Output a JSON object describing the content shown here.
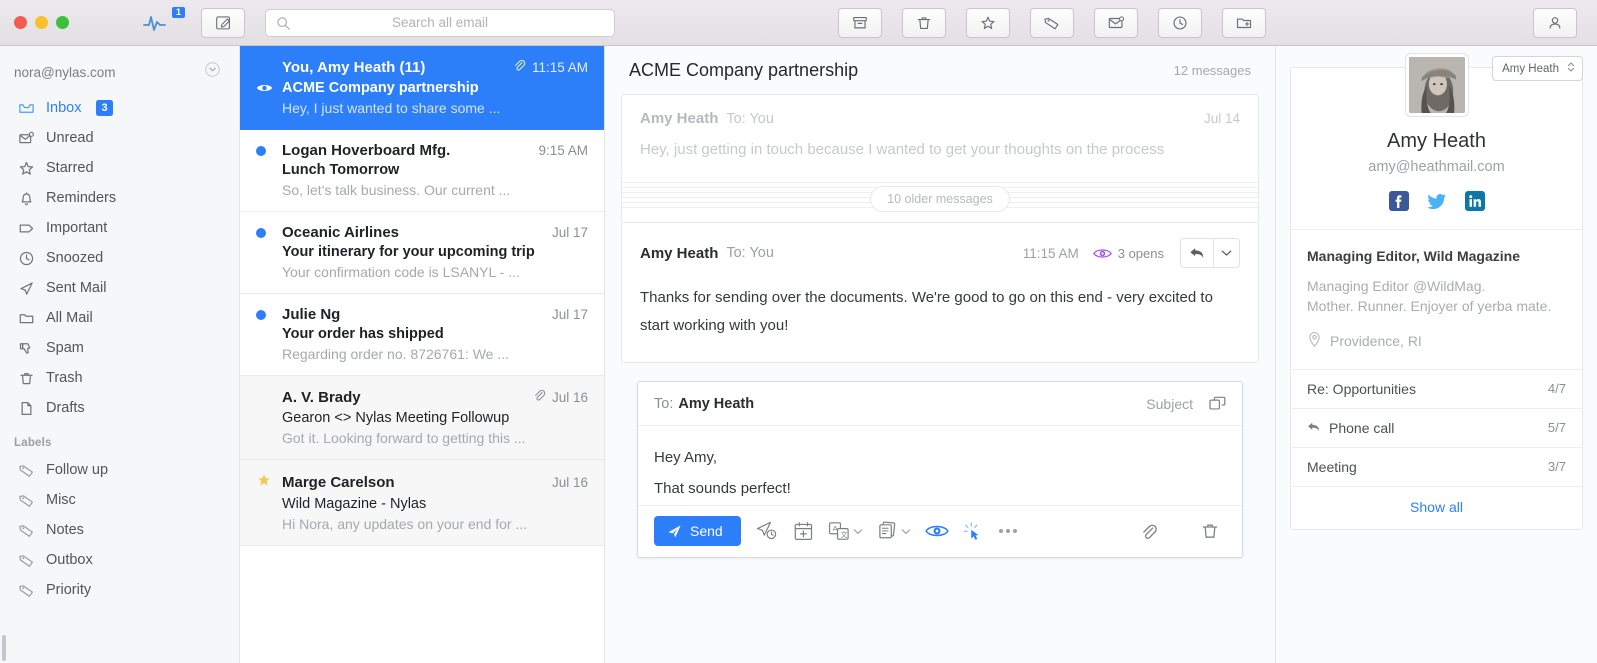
{
  "titlebar": {
    "window_controls": [
      "close",
      "minimize",
      "zoom"
    ],
    "logo_badge": "1",
    "compose_icon": "compose-icon",
    "toolbar_icons": [
      "archive-icon",
      "trash-icon",
      "star-icon",
      "tag-icon",
      "mark-unread-icon",
      "snooze-clock-icon",
      "move-to-folder-icon"
    ],
    "account_icon": "person-icon"
  },
  "search": {
    "placeholder": "Search all email",
    "value": ""
  },
  "sidebar": {
    "account_email": "nora@nylas.com",
    "items": [
      {
        "label": "Inbox",
        "icon": "inbox-icon",
        "badge": "3",
        "active": true
      },
      {
        "label": "Unread",
        "icon": "unread-envelope-icon",
        "badge": "",
        "active": false
      },
      {
        "label": "Starred",
        "icon": "star-icon",
        "badge": "",
        "active": false
      },
      {
        "label": "Reminders",
        "icon": "bell-icon",
        "badge": "",
        "active": false
      },
      {
        "label": "Important",
        "icon": "tag-outline-icon",
        "badge": "",
        "active": false
      },
      {
        "label": "Snoozed",
        "icon": "clock-icon",
        "badge": "",
        "active": false
      },
      {
        "label": "Sent Mail",
        "icon": "paper-plane-icon",
        "badge": "",
        "active": false
      },
      {
        "label": "All Mail",
        "icon": "folder-icon",
        "badge": "",
        "active": false
      },
      {
        "label": "Spam",
        "icon": "thumbs-down-icon",
        "badge": "",
        "active": false
      },
      {
        "label": "Trash",
        "icon": "trash-icon",
        "badge": "",
        "active": false
      },
      {
        "label": "Drafts",
        "icon": "document-icon",
        "badge": "",
        "active": false
      }
    ],
    "labels_header": "Labels",
    "labels": [
      {
        "label": "Follow up",
        "icon": "tag-icon"
      },
      {
        "label": "Misc",
        "icon": "tag-icon"
      },
      {
        "label": "Notes",
        "icon": "tag-icon"
      },
      {
        "label": "Outbox",
        "icon": "tag-icon"
      },
      {
        "label": "Priority",
        "icon": "tag-icon"
      }
    ]
  },
  "threads": [
    {
      "from": "You, Amy Heath (11)",
      "subject": "ACME Company partnership",
      "snippet": "Hey, I just wanted to share some ...",
      "time": "11:15 AM",
      "selected": true,
      "unread": false,
      "attachment": true,
      "starred": false,
      "marker": "eye-icon"
    },
    {
      "from": "Logan Hoverboard Mfg.",
      "subject": "Lunch Tomorrow",
      "snippet": "So, let's talk business. Our current ...",
      "time": "9:15 AM",
      "selected": false,
      "unread": true,
      "attachment": false,
      "starred": false,
      "marker": "unread-dot"
    },
    {
      "from": "Oceanic Airlines",
      "subject": "Your itinerary for your upcoming trip",
      "snippet": "Your confirmation code is LSANYL - ...",
      "time": "Jul 17",
      "selected": false,
      "unread": true,
      "attachment": false,
      "starred": false,
      "marker": "unread-dot"
    },
    {
      "from": "Julie Ng",
      "subject": "Your order has shipped",
      "snippet": "Regarding order no. 8726761: We ...",
      "time": "Jul 17",
      "selected": false,
      "unread": true,
      "attachment": false,
      "starred": false,
      "marker": "unread-dot"
    },
    {
      "from": "A. V. Brady",
      "subject": "Gearon <> Nylas Meeting Followup",
      "snippet": "Got it. Looking forward to getting this ...",
      "time": "Jul 16",
      "selected": false,
      "unread": false,
      "attachment": true,
      "starred": false,
      "marker": ""
    },
    {
      "from": "Marge Carelson",
      "subject": "Wild Magazine - Nylas",
      "snippet": "Hi Nora, any updates on your end for ...",
      "time": "Jul 16",
      "selected": false,
      "unread": false,
      "attachment": false,
      "starred": true,
      "marker": "star-icon"
    }
  ],
  "thread_view": {
    "title": "ACME Company partnership",
    "message_count": "12 messages",
    "older_pill": "10 older messages",
    "messages": [
      {
        "sender": "Amy Heath",
        "recipient": "To: You",
        "date": "Jul 14",
        "body": "Hey, just getting in touch because I wanted to get your thoughts on the process",
        "collapsed": true,
        "opens": ""
      },
      {
        "sender": "Amy Heath",
        "recipient": "To: You",
        "date": "11:15 AM",
        "body": "Thanks for sending over the documents. We're good to go on this end - very excited to start working with you!",
        "collapsed": false,
        "opens": "3 opens"
      }
    ]
  },
  "composer": {
    "to_label": "To:",
    "to_value": "Amy Heath",
    "subject_label": "Subject",
    "popout_icon": "popout-icon",
    "body_lines": [
      "Hey Amy,",
      "That sounds perfect!"
    ],
    "send_label": "Send",
    "toolbar_icons": [
      "send-later-icon",
      "calendar-add-icon",
      "translate-icon",
      "templates-icon",
      "read-receipt-icon",
      "link-tracking-icon",
      "more-options-icon",
      "attachment-icon",
      "delete-draft-icon"
    ]
  },
  "contact": {
    "selector_label": "Amy Heath",
    "name": "Amy Heath",
    "email": "amy@heathmail.com",
    "social": [
      {
        "name": "facebook-icon",
        "color": "#3b5998"
      },
      {
        "name": "twitter-icon",
        "color": "#4ab3f4"
      },
      {
        "name": "linkedin-icon",
        "color": "#0e76a8"
      }
    ],
    "title": "Managing Editor, Wild Magazine",
    "bio_line1": "Managing Editor @WildMag.",
    "bio_line2": "Mother. Runner. Enjoyer of yerba mate.",
    "location": "Providence, RI",
    "activity": [
      {
        "label": "Re: Opportunities",
        "value": "4/7",
        "icon": ""
      },
      {
        "label": "Phone call",
        "value": "5/7",
        "icon": "reply-icon"
      },
      {
        "label": "Meeting",
        "value": "3/7",
        "icon": ""
      }
    ],
    "show_all": "Show all"
  },
  "colors": {
    "accent": "#2d7ff9",
    "badge": "#2d7ff9",
    "star": "#f2c94c",
    "opens_eye": "#a855f7",
    "link": "#2d7ff9"
  }
}
